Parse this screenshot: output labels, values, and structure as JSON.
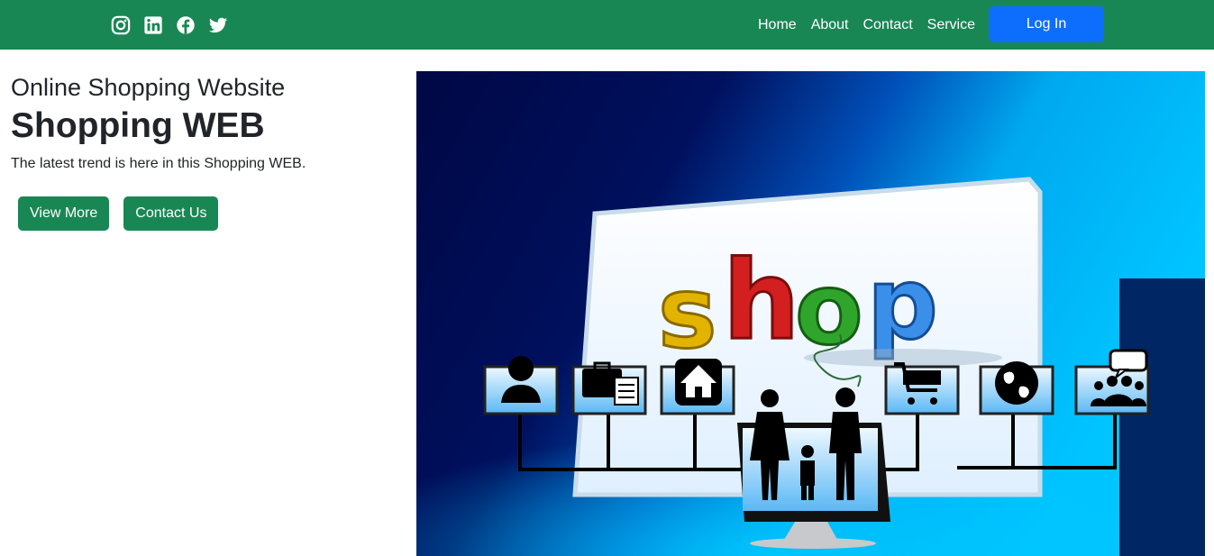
{
  "navbar": {
    "social_icons": [
      "instagram-icon",
      "linkedin-icon",
      "facebook-icon",
      "twitter-icon"
    ],
    "links": [
      "Home",
      "About",
      "Contact",
      "Service"
    ],
    "login_label": "Log In"
  },
  "hero": {
    "subtitle": "Online Shopping Website",
    "title": "Shopping WEB",
    "description": "The latest trend is here in this Shopping WEB.",
    "buttons": {
      "view_more": "View More",
      "contact_us": "Contact Us"
    },
    "image": {
      "shop_letters": [
        "s",
        "h",
        "o",
        "p"
      ],
      "icons": [
        "person-icon",
        "briefcase-document-icon",
        "home-icon",
        "family-icon",
        "cart-icon",
        "globe-icon",
        "group-chat-icon"
      ]
    }
  },
  "colors": {
    "navbar_bg": "#198754",
    "primary_button": "#0d6efd",
    "success_button": "#198754"
  }
}
